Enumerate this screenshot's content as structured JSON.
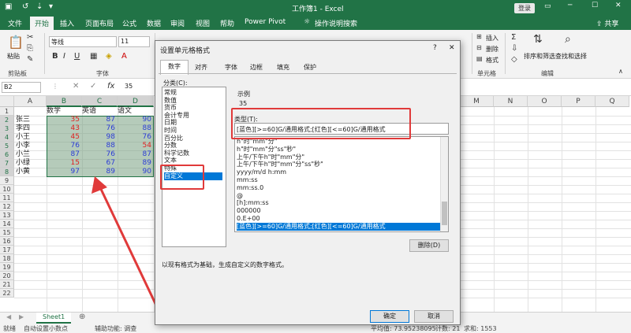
{
  "titlebar": {
    "qat": [
      "↺",
      "⇣",
      "▾"
    ],
    "title": "工作簿1 - Excel",
    "login": "登录",
    "share": "共享"
  },
  "tabs": [
    "文件",
    "开始",
    "插入",
    "页面布局",
    "公式",
    "数据",
    "审阅",
    "视图",
    "帮助",
    "Power Pivot",
    "操作说明搜索"
  ],
  "ribbon": {
    "paste": "粘贴",
    "font_name": "等线",
    "font_size": "11",
    "font_group": "字体",
    "clipboard_group": "剪贴板",
    "insert": "插入",
    "delete": "删除",
    "format": "格式",
    "cells_group": "单元格",
    "sort_filter": "排序和筛选",
    "find_select": "查找和选择",
    "edit_group": "编辑"
  },
  "formula_bar": {
    "name_box": "B2",
    "value": "35",
    "fx": "fx"
  },
  "columns": [
    "A",
    "B",
    "C",
    "D",
    "",
    "",
    "",
    "",
    "M",
    "N",
    "O",
    "P",
    "Q",
    "R"
  ],
  "rows": [
    "1",
    "2",
    "3",
    "4",
    "5",
    "6",
    "7",
    "8",
    "9",
    "10",
    "11",
    "12",
    "13",
    "14",
    "15",
    "16",
    "17",
    "18",
    "19",
    "20",
    "21",
    "22"
  ],
  "table": {
    "header": [
      "",
      "数学",
      "英语",
      "语文"
    ],
    "rows": [
      {
        "name": "张三",
        "v": [
          "35",
          "87",
          "90"
        ]
      },
      {
        "name": "李四",
        "v": [
          "43",
          "76",
          "88"
        ]
      },
      {
        "name": "小王",
        "v": [
          "45",
          "98",
          "76"
        ]
      },
      {
        "name": "小李",
        "v": [
          "76",
          "88",
          "54"
        ]
      },
      {
        "name": "小兰",
        "v": [
          "87",
          "76",
          "87"
        ]
      },
      {
        "name": "小绿",
        "v": [
          "15",
          "67",
          "89"
        ]
      },
      {
        "name": "小黄",
        "v": [
          "97",
          "89",
          "90"
        ]
      }
    ]
  },
  "sheet_tab": "Sheet1",
  "status": {
    "ready": "就绪",
    "auto_decimal": "自动设置小数点",
    "accessibility": "辅助功能: 调查",
    "average": "平均值: 73.95238095",
    "count": "计数: 21",
    "sum": "求和: 1553"
  },
  "dialog": {
    "title": "设置单元格格式",
    "help": "?",
    "close": "✕",
    "tabs": [
      "数字",
      "对齐",
      "字体",
      "边框",
      "填充",
      "保护"
    ],
    "category_label": "分类(C):",
    "categories": [
      "常规",
      "数值",
      "货币",
      "会计专用",
      "日期",
      "时间",
      "百分比",
      "分数",
      "科学记数",
      "文本",
      "特殊",
      "自定义"
    ],
    "sample_label": "示例",
    "sample_value": "35",
    "type_label": "类型(T):",
    "type_value": "[蓝色][>=60]G/通用格式;[红色][<=60]G/通用格式",
    "formats": [
      "h\"时\"mm\"分\"",
      "h\"时\"mm\"分\"ss\"秒\"",
      "上午/下午h\"时\"mm\"分\"",
      "上午/下午h\"时\"mm\"分\"ss\"秒\"",
      "yyyy/m/d h:mm",
      "mm:ss",
      "mm:ss.0",
      "@",
      "[h]:mm:ss",
      "000000",
      "0.E+00",
      "[蓝色][>=60]G/通用格式;[红色][<=60]G/通用格式"
    ],
    "delete_btn": "删除(D)",
    "hint": "以现有格式为基础，生成自定义的数字格式。",
    "ok": "确定",
    "cancel": "取消"
  }
}
